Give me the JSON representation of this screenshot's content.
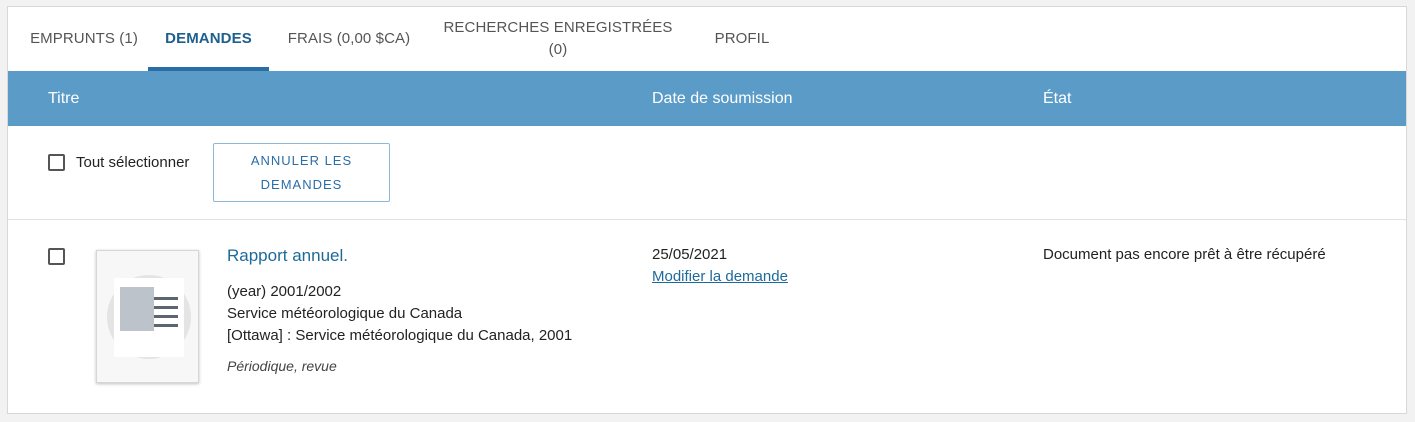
{
  "tabs": [
    {
      "label": "EMPRUNTS (1)",
      "active": false
    },
    {
      "label": "DEMANDES",
      "active": true
    },
    {
      "label": "FRAIS (0,00 $CA)",
      "active": false
    },
    {
      "label_line1": "RECHERCHES ENREGISTRÉES",
      "label_line2": "(0)",
      "active": false
    },
    {
      "label": "PROFIL",
      "active": false
    }
  ],
  "table": {
    "headers": {
      "title": "Titre",
      "date": "Date de soumission",
      "status": "État"
    }
  },
  "select_all": {
    "label": "Tout sélectionner",
    "checked": false
  },
  "cancel_button": {
    "line1": "ANNULER LES",
    "line2": "DEMANDES"
  },
  "requests": [
    {
      "checked": false,
      "title": "Rapport annuel.",
      "year": "(year) 2001/2002",
      "author": "Service météorologique du Canada",
      "publication": "[Ottawa] : Service météorologique du Canada, 2001",
      "type": "Périodique, revue",
      "date": "25/05/2021",
      "edit_link": "Modifier la demande",
      "status": "Document pas encore prêt à être récupéré"
    }
  ],
  "colors": {
    "header_bg": "#5b9bc8",
    "accent": "#2a6ea8",
    "link": "#1d6a9a"
  }
}
